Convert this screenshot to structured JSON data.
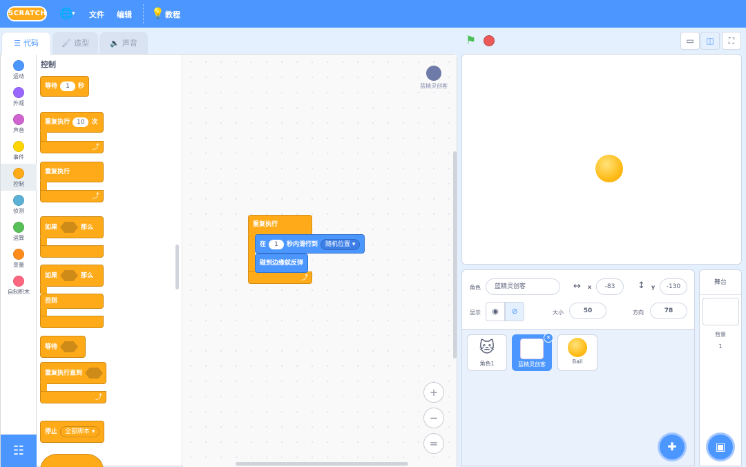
{
  "menubar": {
    "logo": "SCRATCH",
    "globe": "🌐",
    "caret": "▾",
    "file": "文件",
    "edit": "编辑",
    "tutorials": "教程"
  },
  "tabs": [
    {
      "label": "代码",
      "icon": "code-icon",
      "active": true
    },
    {
      "label": "造型",
      "icon": "brush-icon",
      "active": false
    },
    {
      "label": "声音",
      "icon": "speaker-icon",
      "active": false
    }
  ],
  "categories": [
    {
      "label": "运动",
      "color": "#4c97ff"
    },
    {
      "label": "外观",
      "color": "#9966ff"
    },
    {
      "label": "声音",
      "color": "#cf63cf"
    },
    {
      "label": "事件",
      "color": "#ffd500"
    },
    {
      "label": "控制",
      "color": "#ffab19",
      "selected": true
    },
    {
      "label": "侦测",
      "color": "#5cb1d6"
    },
    {
      "label": "运算",
      "color": "#59c059"
    },
    {
      "label": "变量",
      "color": "#ff8c1a"
    },
    {
      "label": "自制积木",
      "color": "#ff6680"
    }
  ],
  "palette": {
    "title": "控制",
    "wait": {
      "label": "等待",
      "value": "1",
      "unit": "秒"
    },
    "repeat": {
      "label": "重复执行",
      "value": "10",
      "unit": "次"
    },
    "forever": {
      "label": "重复执行"
    },
    "if_then": {
      "label": "如果",
      "then": "那么"
    },
    "if_else": {
      "label": "如果",
      "then": "那么",
      "else": "否则"
    },
    "wait_until": {
      "label": "等待"
    },
    "repeat_until": {
      "label": "重复执行直到"
    },
    "stop": {
      "label": "停止",
      "option": "全部脚本"
    }
  },
  "workspace": {
    "watermark": "蓝精灵创客",
    "forever_label": "重复执行",
    "glide": {
      "prefix": "在",
      "value": "1",
      "mid": "秒内滑行到",
      "target": "随机位置"
    },
    "bounce": "碰到边缘就反弹",
    "zoom_in": "+",
    "zoom_out": "−",
    "zoom_reset": "="
  },
  "stage_controls": {
    "flag": "green-flag-icon",
    "stop": "stop-icon"
  },
  "sprite_info": {
    "sprite_label": "角色",
    "sprite_name": "蓝精灵创客",
    "x_label": "x",
    "x_value": "-83",
    "y_label": "y",
    "y_value": "-130",
    "show_label": "显示",
    "size_label": "大小",
    "size_value": "50",
    "direction_label": "方向",
    "direction_value": "78"
  },
  "sprites": [
    {
      "name": "角色1",
      "selected": false
    },
    {
      "name": "蓝精灵创客",
      "selected": true
    },
    {
      "name": "Ball",
      "selected": false
    }
  ],
  "stage_panel": {
    "title": "舞台",
    "backdrop_label": "背景",
    "backdrop_count": "1"
  }
}
